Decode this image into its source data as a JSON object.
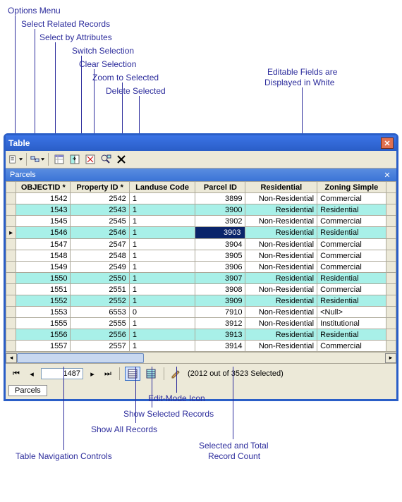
{
  "annotations": {
    "options_menu": "Options Menu",
    "select_related": "Select Related Records",
    "select_by_attr": "Select by Attributes",
    "switch_selection": "Switch Selection",
    "clear_selection": "Clear Selection",
    "zoom_to_selected": "Zoom to Selected",
    "delete_selected": "Delete Selected",
    "editable_note_l1": "Editable Fields are",
    "editable_note_l2": "Displayed in White",
    "edit_mode_icon": "Edit-Mode Icon",
    "show_selected": "Show Selected Records",
    "show_all": "Show All Records",
    "selected_total_l1": "Selected and Total",
    "selected_total_l2": "Record Count",
    "nav_controls": "Table Navigation Controls"
  },
  "window": {
    "title": "Table"
  },
  "subheader": {
    "title": "Parcels"
  },
  "columns": [
    "OBJECTID *",
    "Property ID *",
    "Landuse Code",
    "Parcel ID",
    "Residential",
    "Zoning Simple"
  ],
  "rows": [
    {
      "sel": false,
      "objectid": "1542",
      "propid": "2542",
      "landuse": "1",
      "parcelid": "3899",
      "residential": "Non-Residential",
      "zoning": "Commercial"
    },
    {
      "sel": true,
      "objectid": "1543",
      "propid": "2543",
      "landuse": "1",
      "parcelid": "3900",
      "residential": "Residential",
      "zoning": "Residential"
    },
    {
      "sel": false,
      "objectid": "1545",
      "propid": "2545",
      "landuse": "1",
      "parcelid": "3902",
      "residential": "Non-Residential",
      "zoning": "Commercial"
    },
    {
      "sel": true,
      "objectid": "1546",
      "propid": "2546",
      "landuse": "1",
      "parcelid": "3903",
      "residential": "Residential",
      "zoning": "Residential",
      "ptr": true,
      "editing": "parcelid"
    },
    {
      "sel": false,
      "objectid": "1547",
      "propid": "2547",
      "landuse": "1",
      "parcelid": "3904",
      "residential": "Non-Residential",
      "zoning": "Commercial"
    },
    {
      "sel": false,
      "objectid": "1548",
      "propid": "2548",
      "landuse": "1",
      "parcelid": "3905",
      "residential": "Non-Residential",
      "zoning": "Commercial"
    },
    {
      "sel": false,
      "objectid": "1549",
      "propid": "2549",
      "landuse": "1",
      "parcelid": "3906",
      "residential": "Non-Residential",
      "zoning": "Commercial"
    },
    {
      "sel": true,
      "objectid": "1550",
      "propid": "2550",
      "landuse": "1",
      "parcelid": "3907",
      "residential": "Residential",
      "zoning": "Residential"
    },
    {
      "sel": false,
      "objectid": "1551",
      "propid": "2551",
      "landuse": "1",
      "parcelid": "3908",
      "residential": "Non-Residential",
      "zoning": "Commercial"
    },
    {
      "sel": true,
      "objectid": "1552",
      "propid": "2552",
      "landuse": "1",
      "parcelid": "3909",
      "residential": "Residential",
      "zoning": "Residential"
    },
    {
      "sel": false,
      "objectid": "1553",
      "propid": "6553",
      "landuse": "0",
      "parcelid": "7910",
      "residential": "Non-Residential",
      "zoning": "<Null>"
    },
    {
      "sel": false,
      "objectid": "1555",
      "propid": "2555",
      "landuse": "1",
      "parcelid": "3912",
      "residential": "Non-Residential",
      "zoning": "Institutional"
    },
    {
      "sel": true,
      "objectid": "1556",
      "propid": "2556",
      "landuse": "1",
      "parcelid": "3913",
      "residential": "Residential",
      "zoning": "Residential"
    },
    {
      "sel": false,
      "objectid": "1557",
      "propid": "2557",
      "landuse": "1",
      "parcelid": "3914",
      "residential": "Non-Residential",
      "zoning": "Commercial"
    }
  ],
  "nav": {
    "record": "1487",
    "status": "(2012 out of 3523 Selected)"
  },
  "tab": {
    "label": "Parcels"
  }
}
